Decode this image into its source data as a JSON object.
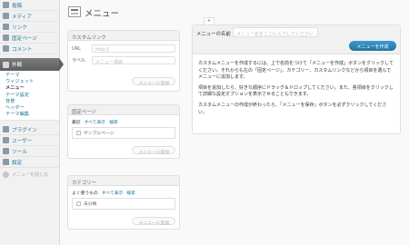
{
  "sidebar": {
    "items": [
      {
        "label": "投稿",
        "icon": "post-icon"
      },
      {
        "label": "メディア",
        "icon": "media-icon"
      },
      {
        "label": "リンク",
        "icon": "link-icon"
      },
      {
        "label": "固定ページ",
        "icon": "page-icon"
      },
      {
        "label": "コメント",
        "icon": "comment-icon"
      }
    ],
    "current": {
      "label": "外観",
      "icon": "appearance-icon"
    },
    "submenu": [
      "テーマ",
      "ウィジェット",
      "メニュー",
      "テーマ設定",
      "背景",
      "ヘッダー",
      "テーマ編集"
    ],
    "submenu_active_index": 2,
    "items_bottom": [
      {
        "label": "プラグイン",
        "icon": "plugin-icon"
      },
      {
        "label": "ユーザー",
        "icon": "user-icon"
      },
      {
        "label": "ツール",
        "icon": "tool-icon"
      },
      {
        "label": "設定",
        "icon": "settings-icon"
      }
    ],
    "collapse_label": "メニューを閉じる"
  },
  "page": {
    "title": "メニュー"
  },
  "custom_link_box": {
    "title": "カスタムリンク",
    "url_label": "URL",
    "url_value": "http://",
    "label_label": "ラベル",
    "label_placeholder": "メニュー項目",
    "add_button": "メニューに追加"
  },
  "pages_box": {
    "title": "固定ページ",
    "tabs": [
      "最近",
      "すべて表示",
      "検索"
    ],
    "item": "サンプルページ",
    "add_button": "メニューに追加"
  },
  "category_box": {
    "title": "カテゴリー",
    "tabs": [
      "よく使うもの",
      "すべて表示",
      "検索"
    ],
    "item": "未分類",
    "add_button": "メニューに追加"
  },
  "menu_panel": {
    "tab_symbol": "+",
    "name_label": "メニューの名前",
    "name_placeholder": "メニュー名をここに入力してください",
    "create_button": "メニューを作成",
    "instructions": [
      "カスタムメニューを作成するには、上で名前をつけて「メニューを作成」ボタンをクリックしてください。それからも左の「固定ページ」、カテゴリー、カスタムリンクなどから項目を選んでメニューに追加します。",
      "項目を追加したら、好きな順序にドラッグ＆ドロップしてください。また、各項目をクリックして詳細な設定オプションを表示させることもできます。",
      "カスタムメニューの作成が終わったら、「メニューを保存」ボタンを必ずクリックしてください。"
    ]
  }
}
